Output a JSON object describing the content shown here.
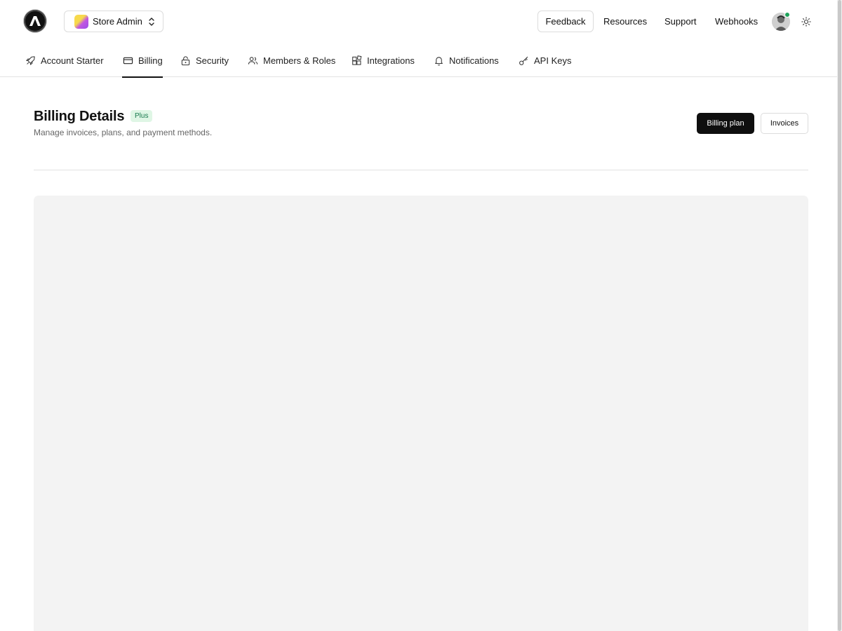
{
  "topbar": {
    "workspace": {
      "name": "Store Admin"
    },
    "links": {
      "feedback": "Feedback",
      "resources": "Resources",
      "support": "Support",
      "webhooks": "Webhooks"
    },
    "user": {
      "status": "online"
    }
  },
  "tabs": [
    {
      "label": "Account Starter",
      "icon": "rocket-icon"
    },
    {
      "label": "Billing",
      "icon": "credit-card-icon",
      "active": true
    },
    {
      "label": "Security",
      "icon": "lock-icon"
    },
    {
      "label": "Members & Roles",
      "icon": "users-icon"
    },
    {
      "label": "Integrations",
      "icon": "puzzle-icon"
    },
    {
      "label": "Notifications",
      "icon": "bell-icon"
    },
    {
      "label": "API Keys",
      "icon": "key-icon"
    }
  ],
  "page": {
    "title": "Billing Details",
    "badge": "Plus",
    "subtitle": "Manage invoices, plans, and payment methods.",
    "actions": {
      "primary": "Billing plan",
      "secondary": "Invoices"
    }
  },
  "colors": {
    "accent": "#0f0f0f",
    "badge_bg": "#dff6e5",
    "badge_text": "#18794e",
    "online": "#1fa35b"
  }
}
